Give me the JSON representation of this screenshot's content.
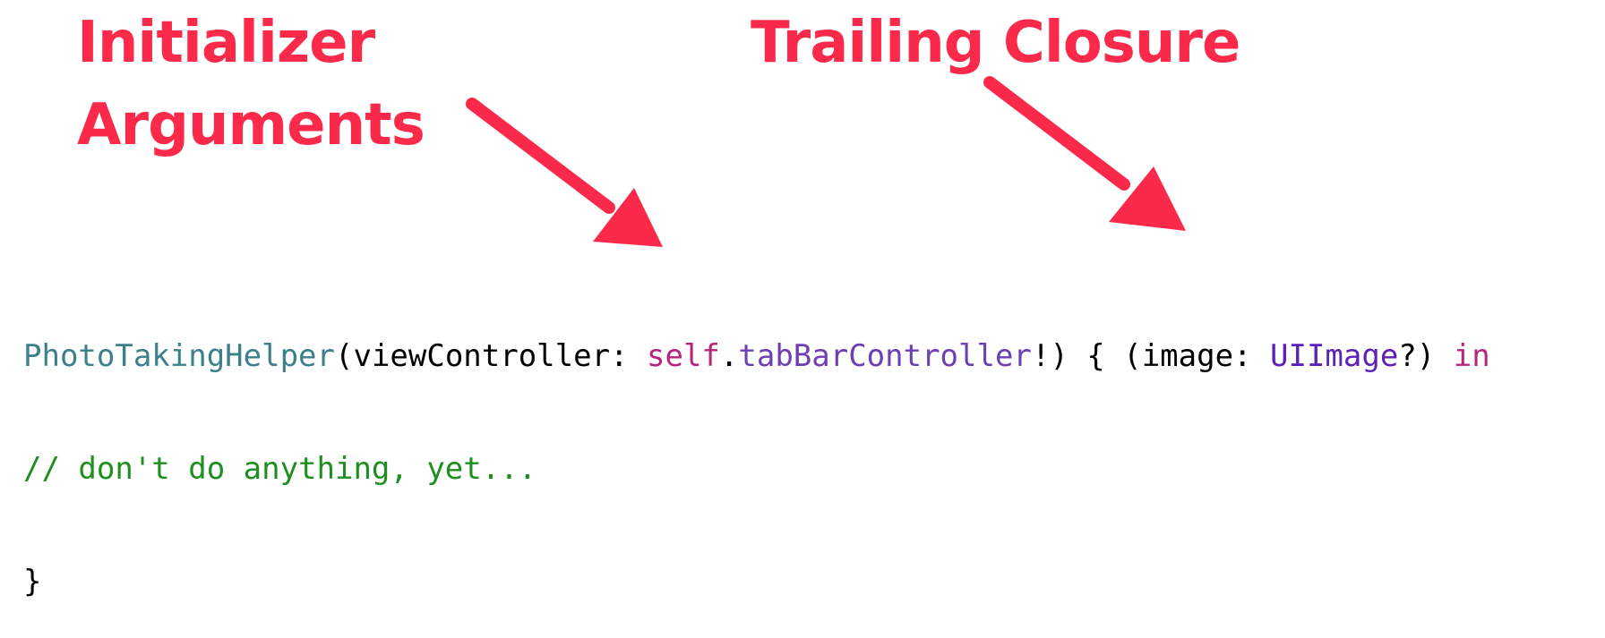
{
  "annotations": {
    "initializer_label": [
      "Initializer",
      "Arguments"
    ],
    "trailing_label": "Trailing Closure"
  },
  "colors": {
    "annotation": "#fc2a4a",
    "code_type": "#3b808a",
    "code_keyword": "#b7247a",
    "code_property": "#6d3fb5",
    "code_class": "#5b22b8",
    "code_comment": "#1e8f1e",
    "code_plain": "#000000"
  },
  "code": {
    "line1": {
      "type_name": "PhotoTakingHelper",
      "open_paren_arg": "(viewController: ",
      "self_kw": "self",
      "dot": ".",
      "property": "tabBarController",
      "after_property": "!) { (image: ",
      "class_name": "UIImage",
      "after_class": "?) ",
      "in_kw": "in"
    },
    "line2": "// don't do anything, yet...",
    "line3": "}"
  }
}
